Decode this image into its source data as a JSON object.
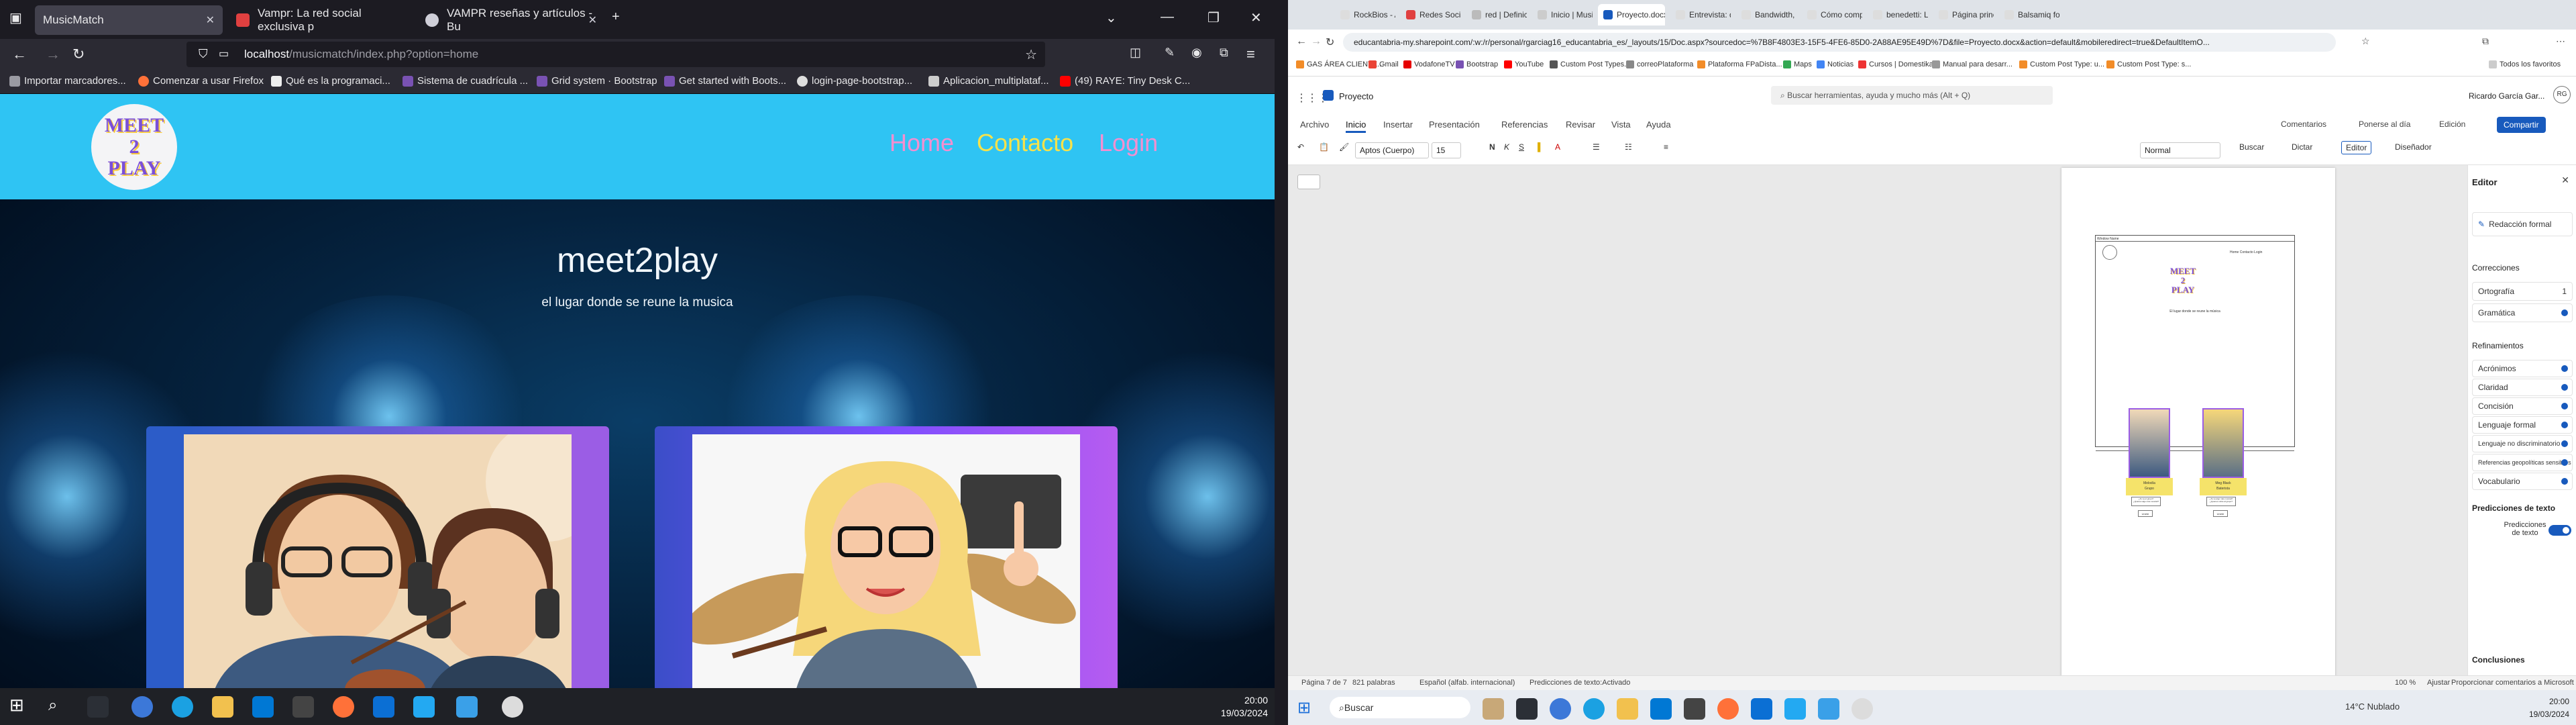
{
  "left": {
    "tabs": [
      {
        "title": "MusicMatch",
        "active": true
      },
      {
        "title": "Vampr: La red social exclusiva p",
        "active": false
      },
      {
        "title": "VAMPR reseñas y artículos - Bu",
        "active": false
      }
    ],
    "url_host": "localhost",
    "url_path": "/musicmatch/index.php?option=home",
    "bookmarks": [
      "Importar marcadores...",
      "Comenzar a usar Firefox",
      "Qué es la programaci...",
      "Sistema de cuadrícula ...",
      "Grid system · Bootstrap",
      "Get started with Boots...",
      "login-page-bootstrap...",
      "Aplicacion_multiplataf...",
      "(49) RAYE: Tiny Desk C..."
    ],
    "site": {
      "logo_line1": "MEET",
      "logo_line2": "2",
      "logo_line3": "PLAY",
      "nav": {
        "home": "Home",
        "contacto": "Contacto",
        "login": "Login"
      },
      "hero_title": "meet2play",
      "hero_subtitle": "el lugar donde se reune la musica"
    },
    "clock_time": "20:00",
    "clock_date": "19/03/2024",
    "colors": {
      "header_bg": "#2fc4f3",
      "nav_pink": "#f48fd0",
      "nav_yellow": "#f7e24a",
      "card_left": "#9b5de5",
      "card_right": "#7c4dff"
    }
  },
  "right": {
    "tabs": [
      "RockBios - Ap",
      "Redes Sociale",
      "red | Definició",
      "Inicio | Musico",
      "Proyecto.docx",
      "Entrevista: doc",
      "Bandwidth, un",
      "Cómo compor",
      "benedetti: La",
      "Página princip",
      "Balsamiq for D"
    ],
    "active_tab_index": 4,
    "url": "educantabria-my.sharepoint.com/:w:/r/personal/rgarciag16_educantabria_es/_layouts/15/Doc.aspx?sourcedoc=%7B8F4803E3-15F5-4FE6-85D0-2A88AE95E49D%7D&file=Proyecto.docx&action=default&mobileredirect=true&DefaultItemO...",
    "bookmarks": [
      "GAS ÁREA CLIENTE...",
      "Gmail",
      "VodafoneTV",
      "Bootstrap",
      "YouTube",
      "Custom Post Types...",
      "correoPlataforma",
      "Plataforma FPaDista...",
      "Maps",
      "Noticias",
      "Cursos | Domestika",
      "Manual para desarr...",
      "Custom Post Type: u...",
      "Custom Post Type: s..."
    ],
    "bookmarks_other": "Todos los favoritos",
    "word": {
      "doc_name": "Proyecto",
      "search_placeholder": "Buscar herramientas, ayuda y mucho más (Alt + Q)",
      "user": "Ricardo García Gar...",
      "user_initials": "RG",
      "ribbon_tabs": [
        "Archivo",
        "Inicio",
        "Insertar",
        "Presentación",
        "Referencias",
        "Revisar",
        "Vista",
        "Ayuda"
      ],
      "active_ribbon_tab": "Inicio",
      "comments_btn": "Comentarios",
      "catch_up_btn": "Ponerse al día",
      "edit_btn": "Edición",
      "share_btn": "Compartir",
      "font": "Aptos (Cuerpo)",
      "size": "15",
      "style": "Normal",
      "find": "Buscar",
      "dictate": "Dictar",
      "editor_btn": "Editor",
      "designer": "Diseñador",
      "page": {
        "wireframe_label": "Window Name",
        "nav": "Home   Contacto   Login",
        "logo": "MEET\n2\nPLAY",
        "subtitle": "El lugar donde se reune la música",
        "card1_label": "Melodía\nGrupo",
        "card2_label": "Meg Black\nBaterista",
        "card1_q": "¿Te va el grupo?\n¿Quieres algo más musical?",
        "card2_q": "¿Te va algo más musical?\n¿Quieres unirte al grupo?",
        "btn": "Unete"
      },
      "editor_panel": {
        "title": "Editor",
        "formal": "Redacción formal",
        "corrections": "Correcciones",
        "spelling": "Ortografía",
        "spelling_count": "1",
        "grammar": "Gramática",
        "refinements": "Refinamientos",
        "refinement_items": [
          "Acrónimos",
          "Claridad",
          "Concisión",
          "Lenguaje formal",
          "Lenguaje no discriminatorio",
          "Referencias geopolíticas sensibles",
          "Vocabulario"
        ],
        "predictions_head": "Predicciones de texto",
        "predictions": "Predicciones de texto",
        "conclusions": "Conclusiones"
      },
      "status": {
        "page": "Página 7 de 7",
        "words": "821 palabras",
        "lang": "Español (alfab. internacional)",
        "predictions": "Predicciones de texto:Activado",
        "zoom": "100 %",
        "fit": "Ajustar",
        "feedback": "Proporcionar comentarios a Microsoft"
      }
    },
    "taskbar_search": "Buscar",
    "weather": "14°C  Nublado",
    "clock_time": "20:00",
    "clock_date": "19/03/2024"
  }
}
